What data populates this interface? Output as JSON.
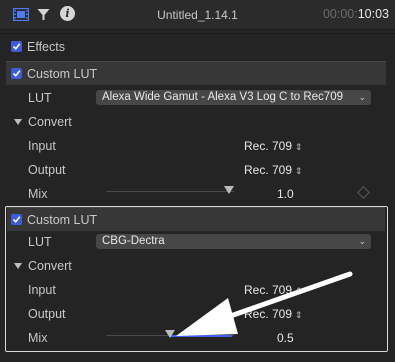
{
  "header": {
    "title": "Untitled_1.14.1",
    "timecode_dim": "00:00:",
    "timecode_bright": "10:03",
    "icons": [
      "film-icon",
      "filter-icon",
      "info-icon"
    ]
  },
  "effects": {
    "label": "Effects",
    "checked": true
  },
  "lut1": {
    "name": "Custom LUT",
    "lut_label": "LUT",
    "lut_value": "Alexa Wide Gamut - Alexa V3 Log C to Rec709",
    "convert_label": "Convert",
    "input_label": "Input",
    "input_value": "Rec. 709",
    "output_label": "Output",
    "output_value": "Rec. 709",
    "mix_label": "Mix",
    "mix_value": "1.0"
  },
  "lut2": {
    "name": "Custom LUT",
    "lut_label": "LUT",
    "lut_value": "CBG-Dectra",
    "convert_label": "Convert",
    "input_label": "Input",
    "input_value": "Rec. 709",
    "output_label": "Output",
    "output_value": "Rec. 709",
    "mix_label": "Mix",
    "mix_value": "0.5"
  },
  "colors": {
    "accent": "#3f5cd8",
    "slider_active": "#4a5cf0"
  }
}
